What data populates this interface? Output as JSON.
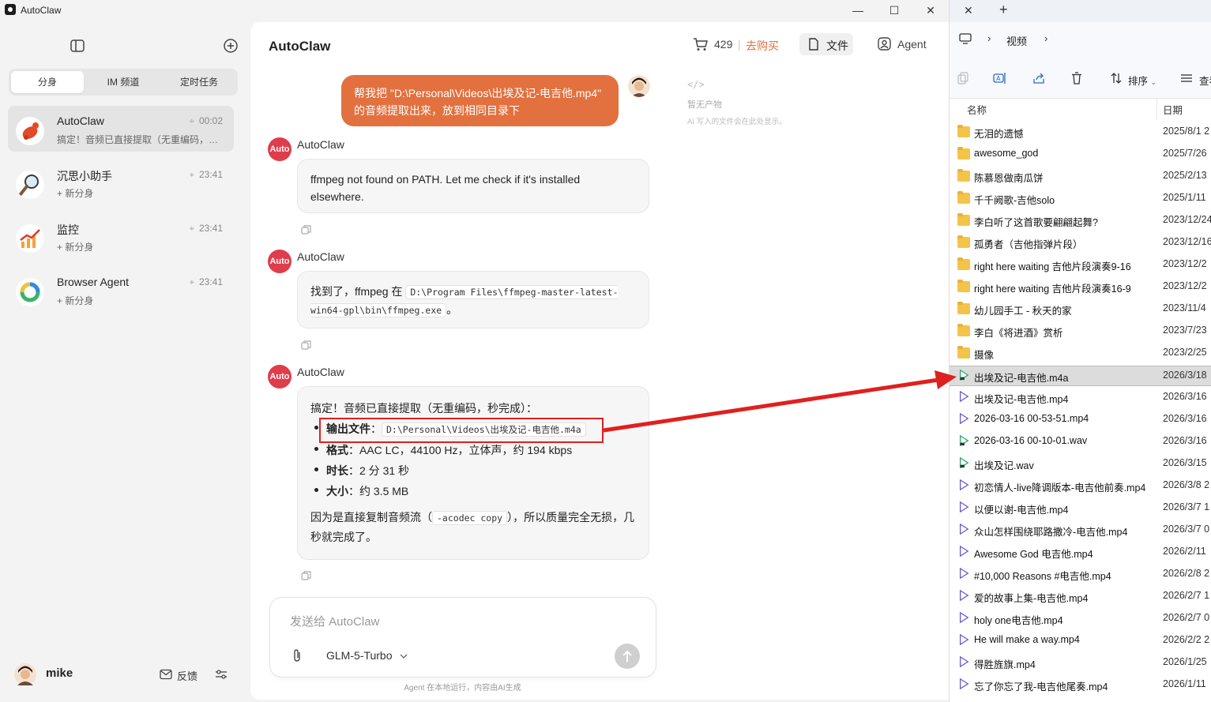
{
  "window": {
    "app_title": "AutoClaw",
    "controls": [
      "—",
      "☐",
      "✕"
    ]
  },
  "sidebar": {
    "segments": [
      "分身",
      "IM 频道",
      "定时任务"
    ],
    "sessions": [
      {
        "title": "AutoClaw",
        "time": "00:02",
        "subtitle": "搞定！音频已直接提取（无重编码，…"
      },
      {
        "title": "沉思小助手",
        "time": "23:41",
        "subtitle": "+ 新分身"
      },
      {
        "title": "监控",
        "time": "23:41",
        "subtitle": "+ 新分身"
      },
      {
        "title": "Browser Agent",
        "time": "23:41",
        "subtitle": "+ 新分身"
      }
    ],
    "user": {
      "name": "mike",
      "feedback_label": "反馈"
    }
  },
  "main": {
    "title": "AutoClaw",
    "credits": "429",
    "buy_label": "去购买",
    "files_label": "文件",
    "agent_label": "Agent",
    "user_message": "帮我把 \"D:\\Personal\\Videos\\出埃及记-电吉他.mp4\" 的音频提取出来，放到相同目录下",
    "bot_name": "AutoClaw",
    "bot_badge": "Auto",
    "msg1": "ffmpeg not found on PATH. Let me check if it's installed elsewhere.",
    "msg2": {
      "prefix": "找到了，ffmpeg 在",
      "path": "D:\\Program Files\\ffmpeg-master-latest-win64-gpl\\bin\\ffmpeg.exe",
      "suffix": "。"
    },
    "msg3": {
      "intro": "搞定！音频已直接提取（无重编码，秒完成）：",
      "items": [
        {
          "label": "输出文件",
          "value": "D:\\Personal\\Videos\\出埃及记-电吉他.m4a"
        },
        {
          "label": "格式",
          "value": "AAC LC，44100 Hz，立体声，约 194 kbps"
        },
        {
          "label": "时长",
          "value": "2 分 31 秒"
        },
        {
          "label": "大小",
          "value": "约 3.5 MB"
        }
      ],
      "outro_prefix": "因为是直接复制音频流（",
      "outro_code": "-acodec copy",
      "outro_suffix": "），所以质量完全无损，几秒就完成了。"
    },
    "artifacts": {
      "title": "暂无产物",
      "hint": "AI 写入的文件会在此处显示。"
    },
    "composer": {
      "placeholder": "发送给 AutoClaw",
      "model": "GLM-5-Turbo"
    },
    "disclaimer": "Agent 在本地运行，内容由AI生成"
  },
  "explorer": {
    "breadcrumb": "视频",
    "sort_label": "排序",
    "view_label": "查看",
    "col_name": "名称",
    "col_date": "日期",
    "files": [
      {
        "name": "无泪的遗憾",
        "date": "2025/8/1 2",
        "type": "folder"
      },
      {
        "name": "awesome_god",
        "date": "2025/7/26",
        "type": "folder"
      },
      {
        "name": "陈慕恩做南瓜饼",
        "date": "2025/2/13",
        "type": "folder"
      },
      {
        "name": "千千阙歌-吉他solo",
        "date": "2025/1/11",
        "type": "folder"
      },
      {
        "name": "李白听了这首歌要翩翩起舞?",
        "date": "2023/12/24",
        "type": "folder"
      },
      {
        "name": "孤勇者（吉他指弹片段）",
        "date": "2023/12/16",
        "type": "folder"
      },
      {
        "name": "right here waiting 吉他片段演奏9-16",
        "date": "2023/12/2",
        "type": "folder"
      },
      {
        "name": "right here waiting 吉他片段演奏16-9",
        "date": "2023/12/2",
        "type": "folder"
      },
      {
        "name": "幼儿园手工 - 秋天的家",
        "date": "2023/11/4",
        "type": "folder"
      },
      {
        "name": "李白《将进酒》赏析",
        "date": "2023/7/23",
        "type": "folder"
      },
      {
        "name": "摄像",
        "date": "2023/2/25",
        "type": "folder"
      },
      {
        "name": "出埃及记-电吉他.m4a",
        "date": "2026/3/18",
        "type": "audio"
      },
      {
        "name": "出埃及记-电吉他.mp4",
        "date": "2026/3/16",
        "type": "video"
      },
      {
        "name": "2026-03-16 00-53-51.mp4",
        "date": "2026/3/16",
        "type": "video"
      },
      {
        "name": "2026-03-16 00-10-01.wav",
        "date": "2026/3/16",
        "type": "audio"
      },
      {
        "name": "出埃及记.wav",
        "date": "2026/3/15",
        "type": "audio"
      },
      {
        "name": "初恋情人-live降调版本-电吉他前奏.mp4",
        "date": "2026/3/8 2",
        "type": "video"
      },
      {
        "name": "以便以谢-电吉他.mp4",
        "date": "2026/3/7 1",
        "type": "video"
      },
      {
        "name": "众山怎样围绕耶路撒冷-电吉他.mp4",
        "date": "2026/3/7 0",
        "type": "video"
      },
      {
        "name": "Awesome God 电吉他.mp4",
        "date": "2026/2/11",
        "type": "video"
      },
      {
        "name": "#10,000 Reasons #电吉他.mp4",
        "date": "2026/2/8 2",
        "type": "video"
      },
      {
        "name": "爱的故事上集-电吉他.mp4",
        "date": "2026/2/7 1",
        "type": "video"
      },
      {
        "name": "holy one电吉他.mp4",
        "date": "2026/2/7 0",
        "type": "video"
      },
      {
        "name": "He will make a way.mp4",
        "date": "2026/2/2 2",
        "type": "video"
      },
      {
        "name": "得胜旌旗.mp4",
        "date": "2026/1/25",
        "type": "video"
      },
      {
        "name": "忘了你忘了我-电吉他尾奏.mp4",
        "date": "2026/1/11",
        "type": "video"
      }
    ]
  },
  "colors": {
    "accent": "#e2713f",
    "buy": "#e2713f",
    "annotation": "#e0201e",
    "bot_badge": "#e03c4b"
  }
}
